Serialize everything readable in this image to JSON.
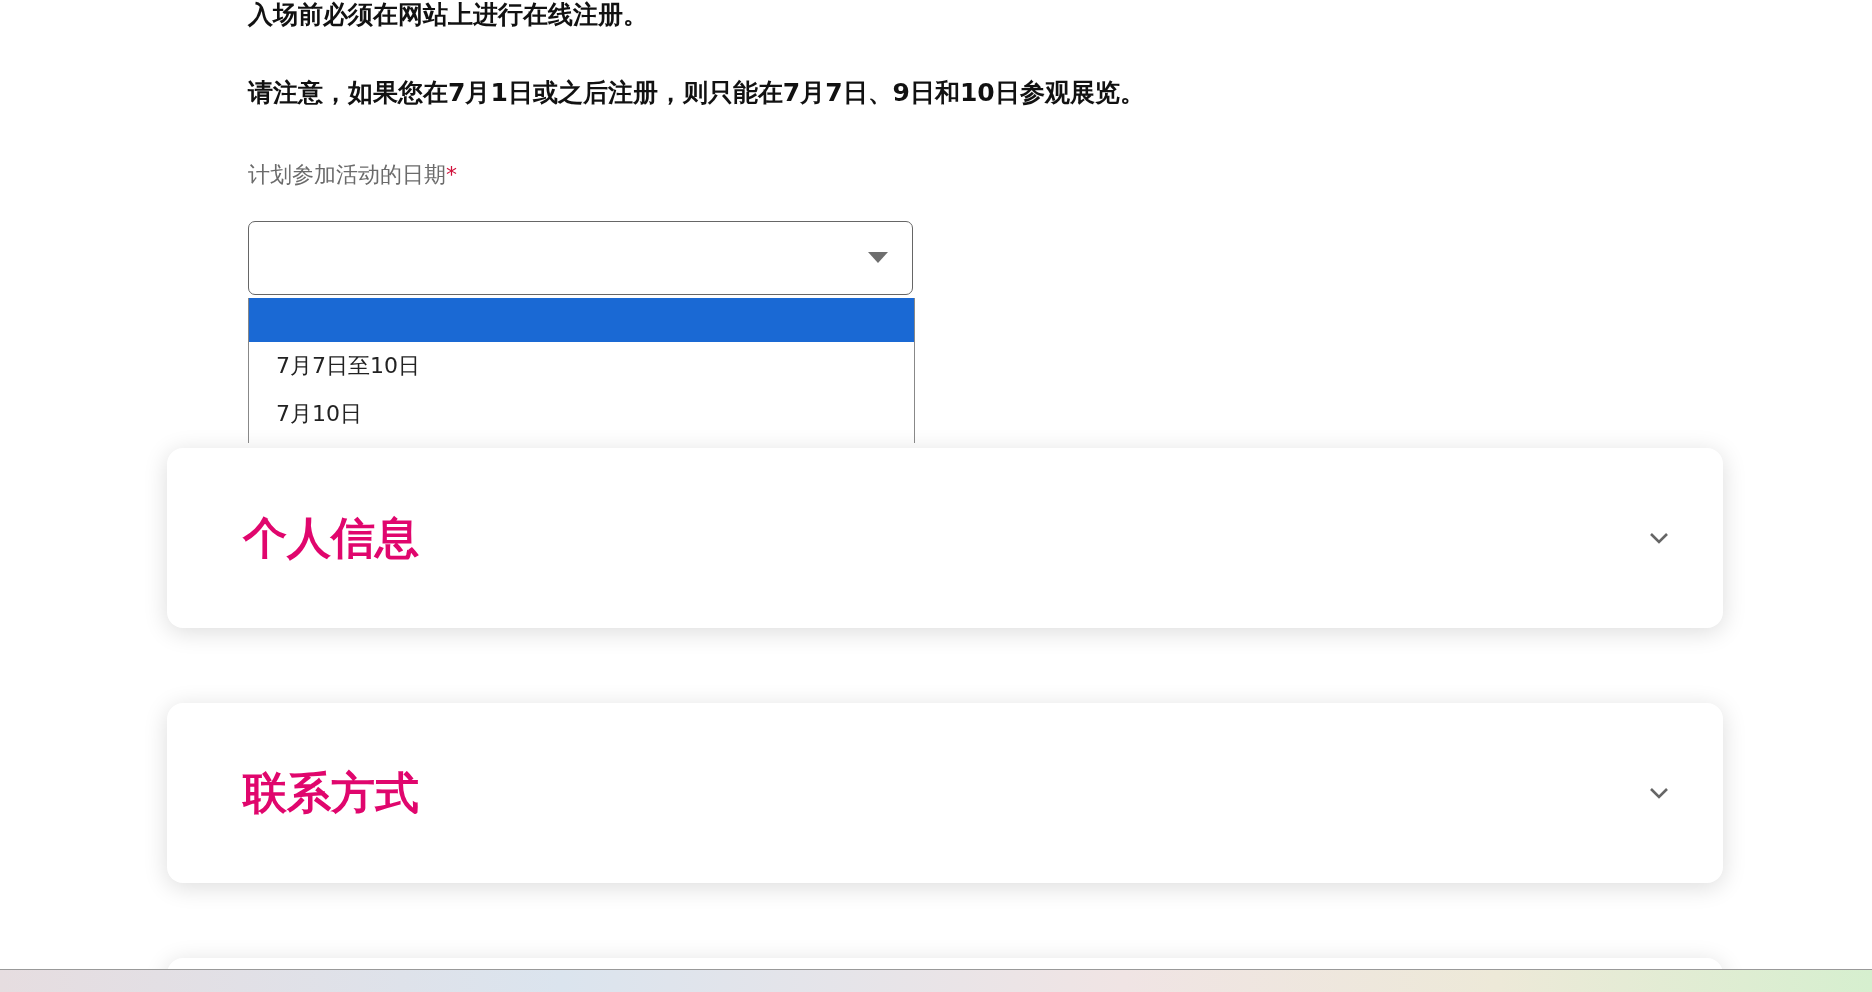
{
  "notices": [
    "入场前必须在网站上进行在线注册。",
    "请注意，如果您在7月1日或之后注册，则只能在7月7日、9日和10日参观展览。"
  ],
  "date_field": {
    "label": "计划参加活动的日期",
    "required_mark": "*",
    "expanded": true,
    "options": [
      {
        "selected": true
      },
      {
        "label": "7月7日至10日",
        "selected": false
      },
      {
        "label": "7月10日",
        "selected": false
      }
    ]
  },
  "sections": [
    {
      "title": "个人信息",
      "expanded": false
    },
    {
      "title": "联系方式",
      "expanded": false
    }
  ]
}
